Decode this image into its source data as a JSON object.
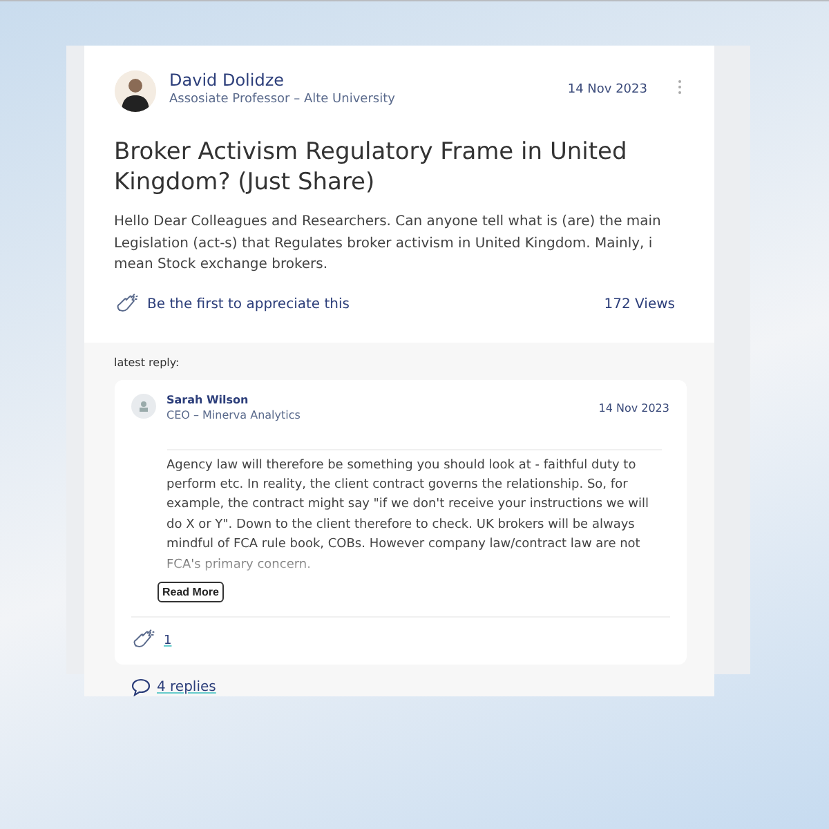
{
  "post": {
    "author": "David Dolidze",
    "role": "Assosiate Professor – Alte University",
    "date": "14 Nov 2023",
    "title": "Broker Activism Regulatory Frame in United Kingdom? (Just Share)",
    "body": "Hello Dear Colleagues and Researchers. Can anyone tell what is (are) the main Legislation (act-s) that Regulates broker activism in United Kingdom. Mainly, i mean Stock exchange brokers.",
    "appreciate": "Be the first to appreciate this",
    "views": "172 Views"
  },
  "latest_reply": {
    "label": "latest reply:",
    "author": "Sarah Wilson",
    "role": "CEO – Minerva Analytics",
    "date": "14 Nov 2023",
    "body": "Agency law will therefore be something you should look at - faithful duty to perform etc. In reality, the client contract governs the relationship. So, for example, the contract might say \"if we don't receive your instructions we will do X or Y\". Down to the client therefore to check. UK brokers will be always mindful of FCA rule book, COBs. However company law/contract law are not FCA's primary concern.",
    "read_more": "Read More",
    "claps": "1"
  },
  "replies_link": "4 replies"
}
